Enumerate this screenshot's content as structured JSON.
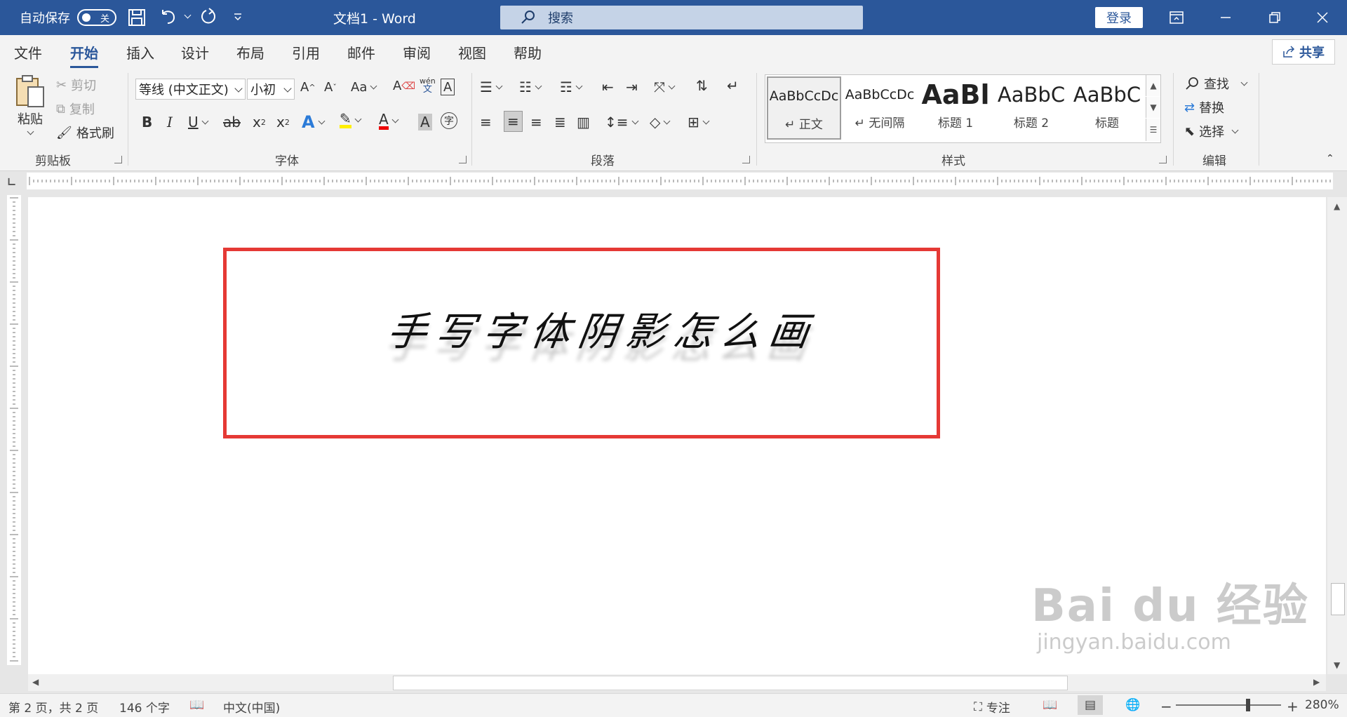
{
  "titlebar": {
    "autosave_label": "自动保存",
    "autosave_state": "关",
    "doc_title": "文档1  -  Word",
    "search_placeholder": "搜索",
    "login_label": "登录"
  },
  "tabs": [
    "文件",
    "开始",
    "插入",
    "设计",
    "布局",
    "引用",
    "邮件",
    "审阅",
    "视图",
    "帮助"
  ],
  "active_tab": "开始",
  "share_label": "共享",
  "ribbon": {
    "clipboard": {
      "paste": "粘贴",
      "cut": "剪切",
      "copy": "复制",
      "format_painter": "格式刷",
      "label": "剪贴板"
    },
    "font": {
      "font_name": "等线 (中文正文)",
      "font_size": "小初",
      "label": "字体"
    },
    "paragraph": {
      "label": "段落"
    },
    "styles": {
      "label": "样式",
      "items": [
        {
          "sample": "AaBbCcDc",
          "name": "↵ 正文"
        },
        {
          "sample": "AaBbCcDc",
          "name": "↵ 无间隔"
        },
        {
          "sample": "AaBl",
          "name": "标题 1"
        },
        {
          "sample": "AaBbC",
          "name": "标题 2"
        },
        {
          "sample": "AaBbC",
          "name": "标题"
        }
      ]
    },
    "editing": {
      "find": "查找",
      "replace": "替换",
      "select": "选择",
      "label": "编辑"
    }
  },
  "document": {
    "text": "手写字体阴影怎么画"
  },
  "statusbar": {
    "page": "第 2 页，共 2 页",
    "words": "146 个字",
    "language": "中文(中国)",
    "focus": "专注",
    "zoom": "280%"
  },
  "watermark": {
    "main": "Bai du 经验",
    "sub": "jingyan.baidu.com"
  },
  "colors": {
    "accent": "#2b579a",
    "textbox_border": "#e53935"
  }
}
